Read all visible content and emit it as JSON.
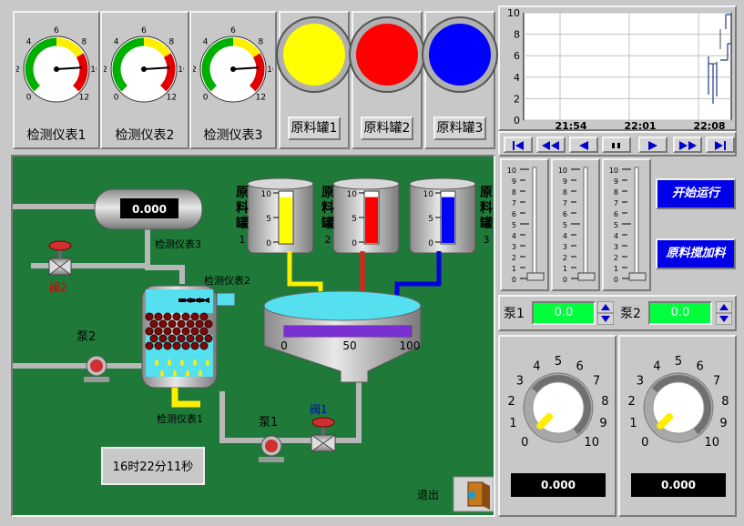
{
  "gauges": [
    {
      "label": "检测仪表1",
      "ticks": [
        "0",
        "2",
        "4",
        "6",
        "8",
        "10",
        "12"
      ],
      "needle_fraction": 0.82
    },
    {
      "label": "检测仪表2",
      "ticks": [
        "0",
        "2",
        "4",
        "6",
        "8",
        "10",
        "12"
      ],
      "needle_fraction": 0.82
    },
    {
      "label": "检测仪表3",
      "ticks": [
        "0",
        "2",
        "4",
        "6",
        "8",
        "10",
        "12"
      ],
      "needle_fraction": 0.82
    }
  ],
  "tank_buttons": [
    {
      "label": "原料罐1",
      "lamp_color": "#ffff00"
    },
    {
      "label": "原料罐2",
      "lamp_color": "#ff0000"
    },
    {
      "label": "原料罐3",
      "lamp_color": "#0000ff"
    }
  ],
  "trend": {
    "y_ticks": [
      "10",
      "8",
      "6",
      "4",
      "2",
      "0"
    ],
    "x_ticks": [
      "21:54",
      "22:01",
      "22:08"
    ]
  },
  "trend_controls": [
    "first",
    "fast-back",
    "back",
    "pause",
    "forward",
    "fast-forward",
    "last"
  ],
  "process": {
    "gauge3_readout": "0.000",
    "gauge3_label": "检测仪表3",
    "gauge2_label": "检测仪表2",
    "gauge1_label": "检测仪表1",
    "valve2_label": "阀2",
    "valve1_label": "阀1",
    "pump2_label": "泵2",
    "pump1_label": "泵1",
    "tanks": [
      {
        "name": "原料罐1",
        "vertical": [
          "原",
          "料",
          "罐",
          "1"
        ],
        "scale": [
          "10",
          "5",
          "0"
        ],
        "fill_color": "#ffff00",
        "level": 0.9
      },
      {
        "name": "原料罐2",
        "vertical": [
          "原",
          "料",
          "罐",
          "2"
        ],
        "scale": [
          "10",
          "5",
          "0"
        ],
        "fill_color": "#ff0000",
        "level": 0.9
      },
      {
        "name": "原料罐3",
        "vertical": [
          "原",
          "料",
          "罐",
          "3"
        ],
        "scale": [
          "10",
          "5",
          "0"
        ],
        "fill_color": "#0000ff",
        "level": 0.9
      }
    ],
    "mixer_scale": [
      "0",
      "50",
      "100"
    ],
    "mixer_level": 1.0,
    "clock": "16时22分11秒",
    "exit_label": "退出"
  },
  "sliders": {
    "ticks": [
      "10",
      "9",
      "8",
      "7",
      "6",
      "5",
      "4",
      "3",
      "2",
      "1",
      "0"
    ],
    "count": 3
  },
  "buttons": {
    "start": "开始运行",
    "add_material": "原料搅加料"
  },
  "pumps": [
    {
      "label": "泵1",
      "value": "0.0"
    },
    {
      "label": "泵2",
      "value": "0.0"
    }
  ],
  "knobs": [
    {
      "ticks": [
        "0",
        "1",
        "2",
        "3",
        "4",
        "5",
        "6",
        "7",
        "8",
        "9",
        "10"
      ],
      "value": 0,
      "readout": "0.000"
    },
    {
      "ticks": [
        "0",
        "1",
        "2",
        "3",
        "4",
        "5",
        "6",
        "7",
        "8",
        "9",
        "10"
      ],
      "value": 0,
      "readout": "0.000"
    }
  ],
  "colors": {
    "process_bg": "#1f7a3a",
    "panel_bg": "#c8c8c8",
    "accent_blue": "#0000e8",
    "field_green": "#00ff3c"
  }
}
